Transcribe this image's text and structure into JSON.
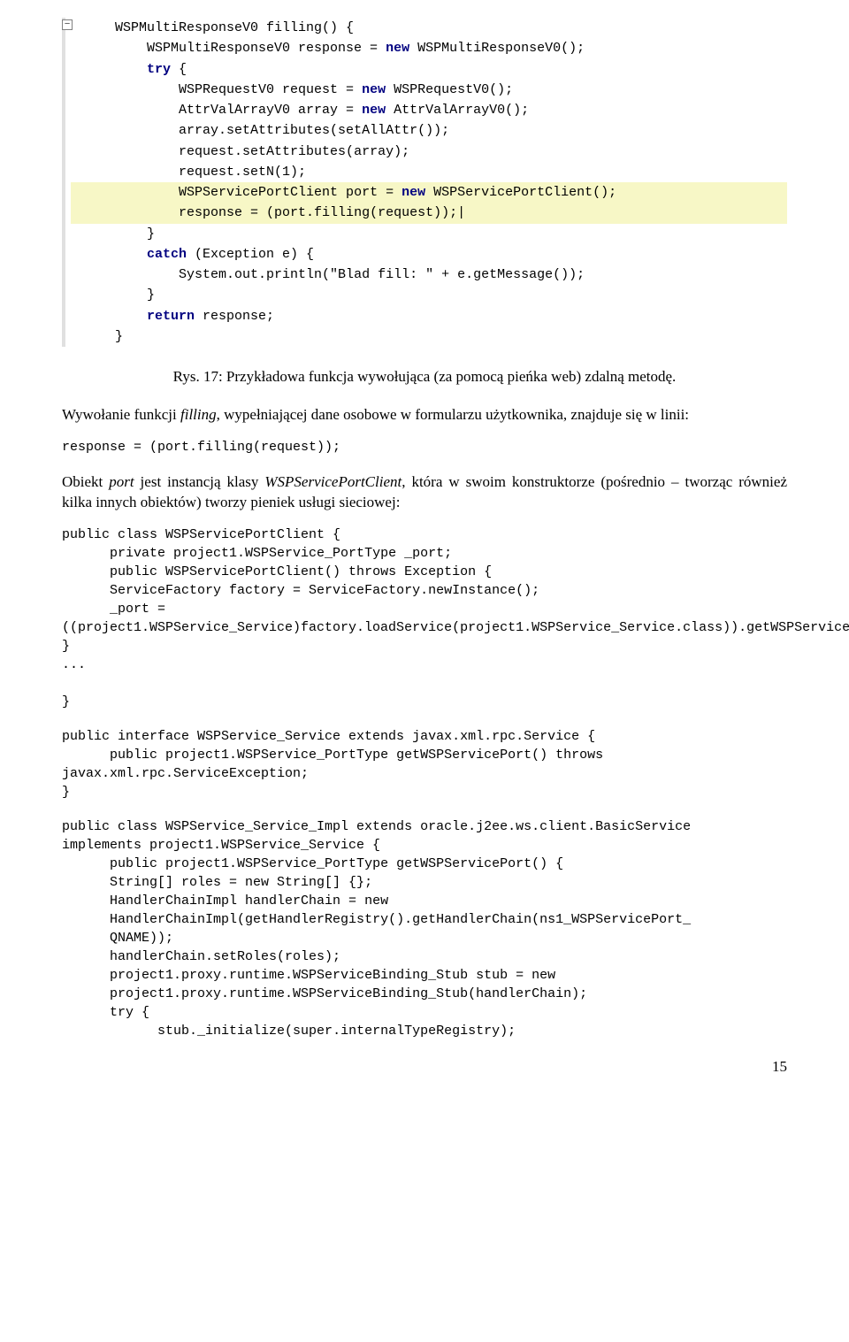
{
  "editor": {
    "fold_glyph": "−",
    "lines": [
      {
        "indent": 1,
        "hl": false,
        "tokens": [
          {
            "t": "pl",
            "v": "WSPMultiResponseV0 filling() {"
          }
        ]
      },
      {
        "indent": 2,
        "hl": false,
        "tokens": [
          {
            "t": "pl",
            "v": "WSPMultiResponseV0 response = "
          },
          {
            "t": "kw",
            "v": "new"
          },
          {
            "t": "pl",
            "v": " WSPMultiResponseV0();"
          }
        ]
      },
      {
        "indent": 2,
        "hl": false,
        "tokens": [
          {
            "t": "kw",
            "v": "try"
          },
          {
            "t": "pl",
            "v": " {"
          }
        ]
      },
      {
        "indent": 3,
        "hl": false,
        "tokens": [
          {
            "t": "pl",
            "v": "WSPRequestV0 request = "
          },
          {
            "t": "kw",
            "v": "new"
          },
          {
            "t": "pl",
            "v": " WSPRequestV0();"
          }
        ]
      },
      {
        "indent": 3,
        "hl": false,
        "tokens": [
          {
            "t": "pl",
            "v": "AttrValArrayV0 array = "
          },
          {
            "t": "kw",
            "v": "new"
          },
          {
            "t": "pl",
            "v": " AttrValArrayV0();"
          }
        ]
      },
      {
        "indent": 3,
        "hl": false,
        "tokens": [
          {
            "t": "pl",
            "v": "array.setAttributes(setAllAttr());"
          }
        ]
      },
      {
        "indent": 3,
        "hl": false,
        "tokens": [
          {
            "t": "pl",
            "v": "request.setAttributes(array);"
          }
        ]
      },
      {
        "indent": 3,
        "hl": false,
        "tokens": [
          {
            "t": "pl",
            "v": "request.setN(1);"
          }
        ]
      },
      {
        "indent": 3,
        "hl": true,
        "tokens": [
          {
            "t": "pl",
            "v": "WSPServicePortClient port = "
          },
          {
            "t": "kw",
            "v": "new"
          },
          {
            "t": "pl",
            "v": " WSPServicePortClient();"
          }
        ]
      },
      {
        "indent": 3,
        "hl": true,
        "tokens": [
          {
            "t": "pl",
            "v": "response = (port.filling(request));|"
          }
        ]
      },
      {
        "indent": 2,
        "hl": false,
        "tokens": [
          {
            "t": "pl",
            "v": "}"
          }
        ]
      },
      {
        "indent": 2,
        "hl": false,
        "tokens": [
          {
            "t": "kw",
            "v": "catch"
          },
          {
            "t": "pl",
            "v": " (Exception e) {"
          }
        ]
      },
      {
        "indent": 3,
        "hl": false,
        "tokens": [
          {
            "t": "pl",
            "v": "System.out.println(\"Blad fill: \" + e.getMessage());"
          }
        ]
      },
      {
        "indent": 2,
        "hl": false,
        "tokens": [
          {
            "t": "pl",
            "v": "}"
          }
        ]
      },
      {
        "indent": 2,
        "hl": false,
        "tokens": [
          {
            "t": "kw",
            "v": "return"
          },
          {
            "t": "pl",
            "v": " response;"
          }
        ]
      },
      {
        "indent": 1,
        "hl": false,
        "tokens": [
          {
            "t": "pl",
            "v": "}"
          }
        ]
      }
    ]
  },
  "caption": {
    "prefix": "Rys. 17: Przykładowa funkcja wywołująca (za pomocą pieńka ",
    "italic": "web",
    "suffix": ") zdalną metodę."
  },
  "para1": {
    "t1": "Wywołanie funkcji ",
    "i1": "filling",
    "t2": ", wypełniającej dane osobowe w formularzu użytkownika, znajduje się w linii:"
  },
  "code_inline1": "response = (port.filling(request));",
  "para2": {
    "t1": "Obiekt ",
    "i1": "port",
    "t2": " jest instancją klasy ",
    "i2": "WSPServicePortClient",
    "t3": ", która w swoim konstruktorze (pośrednio – tworząc również kilka innych obiektów) tworzy pieniek usługi sieciowej:"
  },
  "codeblock1": "public class WSPServicePortClient {\n      private project1.WSPService_PortType _port;\n      public WSPServicePortClient() throws Exception {\n      ServiceFactory factory = ServiceFactory.newInstance();\n      _port =\n((project1.WSPService_Service)factory.loadService(project1.WSPService_Service.class)).getWSPServicePort();\n}\n...\n\n}",
  "codeblock2": "public interface WSPService_Service extends javax.xml.rpc.Service {\n      public project1.WSPService_PortType getWSPServicePort() throws\njavax.xml.rpc.ServiceException;\n}",
  "codeblock3": "public class WSPService_Service_Impl extends oracle.j2ee.ws.client.BasicService\nimplements project1.WSPService_Service {\n      public project1.WSPService_PortType getWSPServicePort() {\n      String[] roles = new String[] {};\n      HandlerChainImpl handlerChain = new\n      HandlerChainImpl(getHandlerRegistry().getHandlerChain(ns1_WSPServicePort_\n      QNAME));\n      handlerChain.setRoles(roles);\n      project1.proxy.runtime.WSPServiceBinding_Stub stub = new\n      project1.proxy.runtime.WSPServiceBinding_Stub(handlerChain);\n      try {\n            stub._initialize(super.internalTypeRegistry);",
  "page_number": "15"
}
